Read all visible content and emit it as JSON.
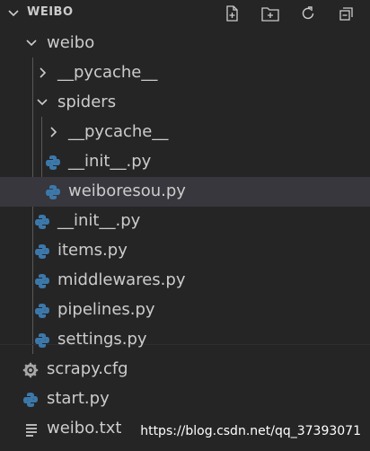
{
  "explorer": {
    "title": "WEIBO",
    "actions": [
      "new-file-icon",
      "new-folder-icon",
      "refresh-icon",
      "collapse-all-icon"
    ]
  },
  "tree": {
    "weibo": "weibo",
    "pycache_1": "__pycache__",
    "spiders": "spiders",
    "pycache_2": "__pycache__",
    "init_spiders": "__init__.py",
    "weiboresou": "weiboresou.py",
    "init_weibo": "__init__.py",
    "items": "items.py",
    "middlewares": "middlewares.py",
    "pipelines": "pipelines.py",
    "settings": "settings.py",
    "scrapy_cfg": "scrapy.cfg",
    "start": "start.py",
    "weibo_txt": "weibo.txt"
  },
  "watermark": "https://blog.csdn.net/qq_37393071",
  "colors": {
    "background": "#252526",
    "selected": "#37373d",
    "text": "#cccccc",
    "python_blue": "#3c78aa",
    "python_yellow": "#ffd43b"
  }
}
